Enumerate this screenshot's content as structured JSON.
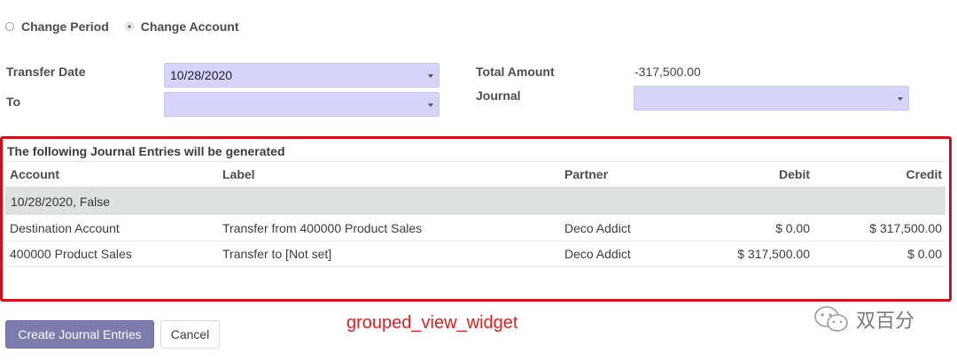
{
  "mode_options": [
    {
      "label": "Change Period",
      "selected": false
    },
    {
      "label": "Change Account",
      "selected": true
    }
  ],
  "form": {
    "transfer_date_label": "Transfer Date",
    "transfer_date_value": "10/28/2020",
    "to_label": "To",
    "to_value": "",
    "total_amount_label": "Total Amount",
    "total_amount_value": "-317,500.00",
    "journal_label": "Journal",
    "journal_value": ""
  },
  "grouped_view": {
    "title": "The following Journal Entries will be generated",
    "columns": {
      "account": "Account",
      "label": "Label",
      "partner": "Partner",
      "debit": "Debit",
      "credit": "Credit"
    },
    "group_header": "10/28/2020, False",
    "rows": [
      {
        "account": "Destination Account",
        "label": "Transfer from 400000 Product Sales",
        "partner": "Deco Addict",
        "debit": "$ 0.00",
        "credit": "$ 317,500.00"
      },
      {
        "account": "400000 Product Sales",
        "label": "Transfer to [Not set]",
        "partner": "Deco Addict",
        "debit": "$ 317,500.00",
        "credit": "$ 0.00"
      }
    ]
  },
  "buttons": {
    "create": "Create Journal Entries",
    "cancel": "Cancel"
  },
  "annotation": "grouped_view_widget",
  "watermark": "双百分",
  "colors": {
    "highlight_border": "#d0111b",
    "primary_button": "#7c7bad",
    "field_bg": "#d6d4fb",
    "annotation_text": "#e02020"
  }
}
